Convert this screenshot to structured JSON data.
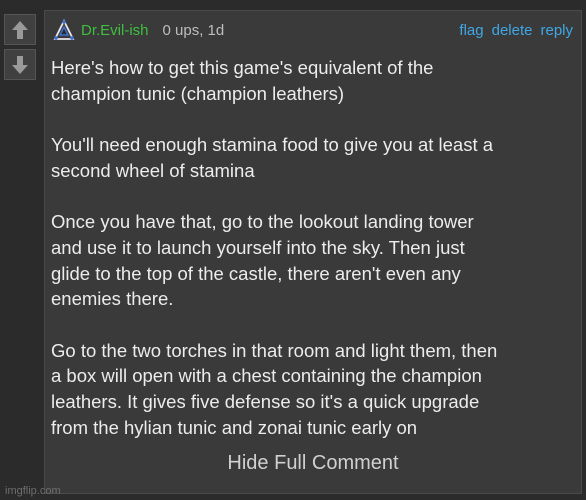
{
  "comment": {
    "username": "Dr.Evil-ish",
    "meta": "0 ups, 1d",
    "actions": {
      "flag": "flag",
      "delete": "delete",
      "reply": "reply"
    },
    "paragraphs": [
      "Here's how to get this game's equivalent of the\nchampion tunic (champion leathers)",
      "You'll need enough stamina food to give you at least a\nsecond wheel of stamina",
      "Once you have that, go to the lookout landing tower\nand use it to launch yourself into the sky. Then just\nglide to the top of the castle, there aren't even any\nenemies there.",
      "Go to the two torches in that room and light them, then\na box will open with a chest containing the champion\nleathers. It gives five defense so it's a quick upgrade\nfrom the hylian tunic and zonai tunic early on"
    ],
    "hide_label": "Hide Full Comment"
  },
  "icons": {
    "upvote": "arrow-up-icon",
    "downvote": "arrow-down-icon",
    "avatar": "triforce-avatar-icon"
  },
  "colors": {
    "username": "#3fbf3f",
    "link": "#3fa7e6",
    "background": "#2b2b2b",
    "panel": "#3a3a3a"
  },
  "watermark": "imgflip.com"
}
